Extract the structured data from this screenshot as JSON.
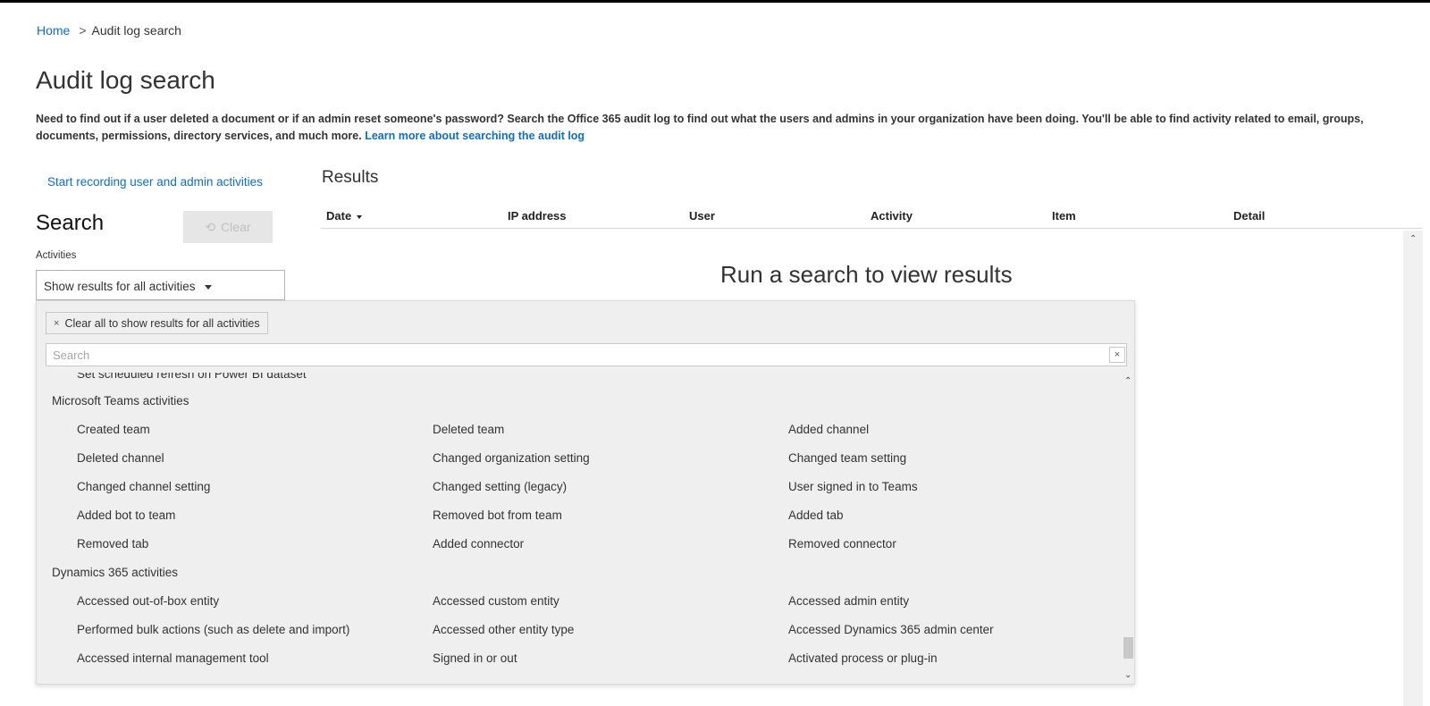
{
  "breadcrumb": {
    "home": "Home",
    "separator": ">",
    "current": "Audit log search"
  },
  "page": {
    "title": "Audit log search",
    "intro": "Need to find out if a user deleted a document or if an admin reset someone's password? Search the Office 365 audit log to find out what the users and admins in your organization have been doing. You'll be able to find activity related to email, groups, documents, permissions, directory services, and much more.",
    "learn_more": "Learn more about searching the audit log"
  },
  "search": {
    "start_recording": "Start recording user and admin activities",
    "heading": "Search",
    "clear_label": "Clear",
    "activities_label": "Activities",
    "activities_value": "Show results for all activities"
  },
  "results": {
    "title": "Results",
    "columns": [
      "Date",
      "IP address",
      "User",
      "Activity",
      "Item",
      "Detail"
    ],
    "empty_message": "Run a search to view results"
  },
  "activities_panel": {
    "clear_all": "Clear all to show results for all activities",
    "search_placeholder": "Search",
    "partial_item": "Set scheduled refresh on Power BI dataset",
    "groups": [
      {
        "title": "Microsoft Teams activities",
        "items": [
          "Created team",
          "Deleted team",
          "Added channel",
          "Deleted channel",
          "Changed organization setting",
          "Changed team setting",
          "Changed channel setting",
          "Changed setting (legacy)",
          "User signed in to Teams",
          "Added bot to team",
          "Removed bot from team",
          "Added tab",
          "Removed tab",
          "Added connector",
          "Removed connector"
        ]
      },
      {
        "title": "Dynamics 365 activities",
        "items": [
          "Accessed out-of-box entity",
          "Accessed custom entity",
          "Accessed admin entity",
          "Performed bulk actions (such as delete and import)",
          "Accessed other entity type",
          "Accessed Dynamics 365 admin center",
          "Accessed internal management tool",
          "Signed in or out",
          "Activated process or plug-in"
        ]
      }
    ]
  },
  "icons": {
    "clear": "undo-icon",
    "caret": "caret-down-icon",
    "close": "close-icon"
  },
  "colors": {
    "link": "#106ebe",
    "panel_bg": "#efefef"
  }
}
